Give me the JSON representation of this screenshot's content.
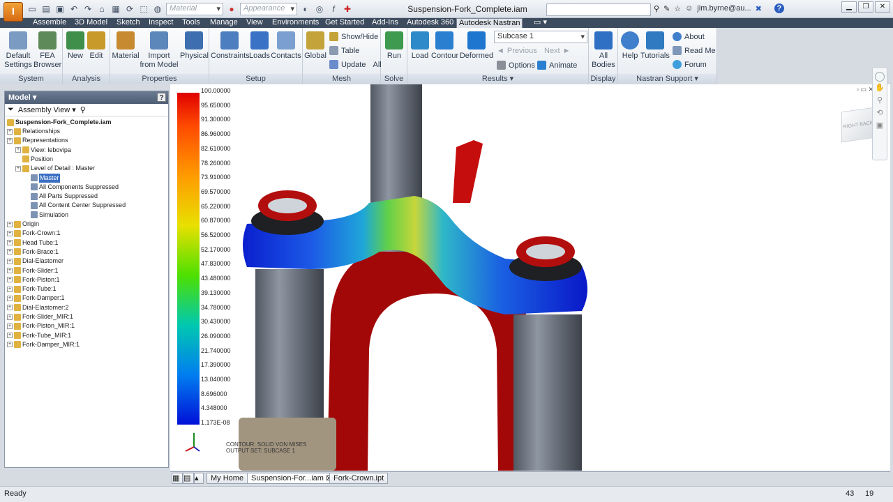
{
  "titlebar": {
    "app_letter": "I",
    "material_placeholder": "Material",
    "appearance_placeholder": "Appearance",
    "window_title": "Suspension-Fork_Complete.iam",
    "user": "jim.byrne@au...",
    "help": "?"
  },
  "menu_tabs": [
    "Assemble",
    "3D Model",
    "Sketch",
    "Inspect",
    "Tools",
    "Manage",
    "View",
    "Environments",
    "Get Started",
    "Add-Ins",
    "Autodesk 360",
    "Autodesk Nastran"
  ],
  "ribbon": {
    "system": {
      "label": "System",
      "default_settings": "Default Settings",
      "fea_browser": "FEA Browser"
    },
    "analysis": {
      "label": "Analysis",
      "new": "New",
      "edit": "Edit"
    },
    "properties": {
      "label": "Properties",
      "material": "Material",
      "import_from_model": "Import from Model",
      "physical": "Physical"
    },
    "setup": {
      "label": "Setup",
      "constraints": "Constraints",
      "loads": "Loads",
      "contacts": "Contacts"
    },
    "mesh": {
      "label": "Mesh",
      "global": "Global",
      "show_hide": "Show/Hide",
      "table": "Table",
      "update": "Update",
      "all": "All"
    },
    "solve": {
      "label": "Solve",
      "run": "Run"
    },
    "results": {
      "label": "Results",
      "load": "Load",
      "contour": "Contour",
      "deformed": "Deformed",
      "subcase": "Subcase 1",
      "previous": "Previous",
      "next": "Next",
      "options": "Options",
      "animate": "Animate"
    },
    "display": {
      "label": "Display",
      "all_bodies": "All Bodies"
    },
    "support": {
      "label": "Nastran Support",
      "help": "Help",
      "tutorials": "Tutorials",
      "about": "About",
      "read_me": "Read Me",
      "forum": "Forum"
    }
  },
  "browser": {
    "title": "Model",
    "help": "?",
    "view_mode": "Assembly View",
    "root": "Suspension-Fork_Complete.iam",
    "items": [
      {
        "label": "Relationships",
        "indent": 1,
        "expand": true
      },
      {
        "label": "Representations",
        "indent": 1,
        "expand": true
      },
      {
        "label": "View: lebovipa",
        "indent": 2,
        "expand": true
      },
      {
        "label": "Position",
        "indent": 2,
        "expand": false
      },
      {
        "label": "Level of Detail : Master",
        "indent": 2,
        "expand": true
      },
      {
        "label": "Master",
        "indent": 3,
        "expand": false,
        "selected": true
      },
      {
        "label": "All Components Suppressed",
        "indent": 3,
        "expand": false
      },
      {
        "label": "All Parts Suppressed",
        "indent": 3,
        "expand": false
      },
      {
        "label": "All Content Center Suppressed",
        "indent": 3,
        "expand": false
      },
      {
        "label": "Simulation",
        "indent": 3,
        "expand": false
      },
      {
        "label": "Origin",
        "indent": 1,
        "expand": true
      },
      {
        "label": "Fork-Crown:1",
        "indent": 1,
        "expand": true
      },
      {
        "label": "Head Tube:1",
        "indent": 1,
        "expand": true
      },
      {
        "label": "Fork-Brace:1",
        "indent": 1,
        "expand": true
      },
      {
        "label": "Dial-Elastomer",
        "indent": 1,
        "expand": true
      },
      {
        "label": "Fork-Slider:1",
        "indent": 1,
        "expand": true
      },
      {
        "label": "Fork-Piston:1",
        "indent": 1,
        "expand": true
      },
      {
        "label": "Fork-Tube:1",
        "indent": 1,
        "expand": true
      },
      {
        "label": "Fork-Damper:1",
        "indent": 1,
        "expand": true
      },
      {
        "label": "Dial-Elastomer:2",
        "indent": 1,
        "expand": true
      },
      {
        "label": "Fork-Slider_MIR:1",
        "indent": 1,
        "expand": true
      },
      {
        "label": "Fork-Piston_MIR:1",
        "indent": 1,
        "expand": true
      },
      {
        "label": "Fork-Tube_MIR:1",
        "indent": 1,
        "expand": true
      },
      {
        "label": "Fork-Damper_MIR:1",
        "indent": 1,
        "expand": true
      }
    ]
  },
  "legend": {
    "values": [
      "100.00000",
      "95.650000",
      "91.300000",
      "86.960000",
      "82.610000",
      "78.260000",
      "73.910000",
      "69.570000",
      "65.220000",
      "60.870000",
      "56.520000",
      "52.170000",
      "47.830000",
      "43.480000",
      "39.130000",
      "34.780000",
      "30.430000",
      "26.090000",
      "21.740000",
      "17.390000",
      "13.040000",
      "8.696000",
      "4.348000",
      "1.173E-08"
    ],
    "caption_line1": "CONTOUR: SOLID VON MISES",
    "caption_line2": "OUTPUT SET: SUBCASE 1"
  },
  "viewcube": {
    "right": "RIGHT",
    "back": "BACK"
  },
  "doc_tabs": [
    "My Home",
    "Suspension-For...iam",
    "Fork-Crown.ipt"
  ],
  "status": {
    "text": "Ready",
    "num1": "43",
    "num2": "19"
  }
}
